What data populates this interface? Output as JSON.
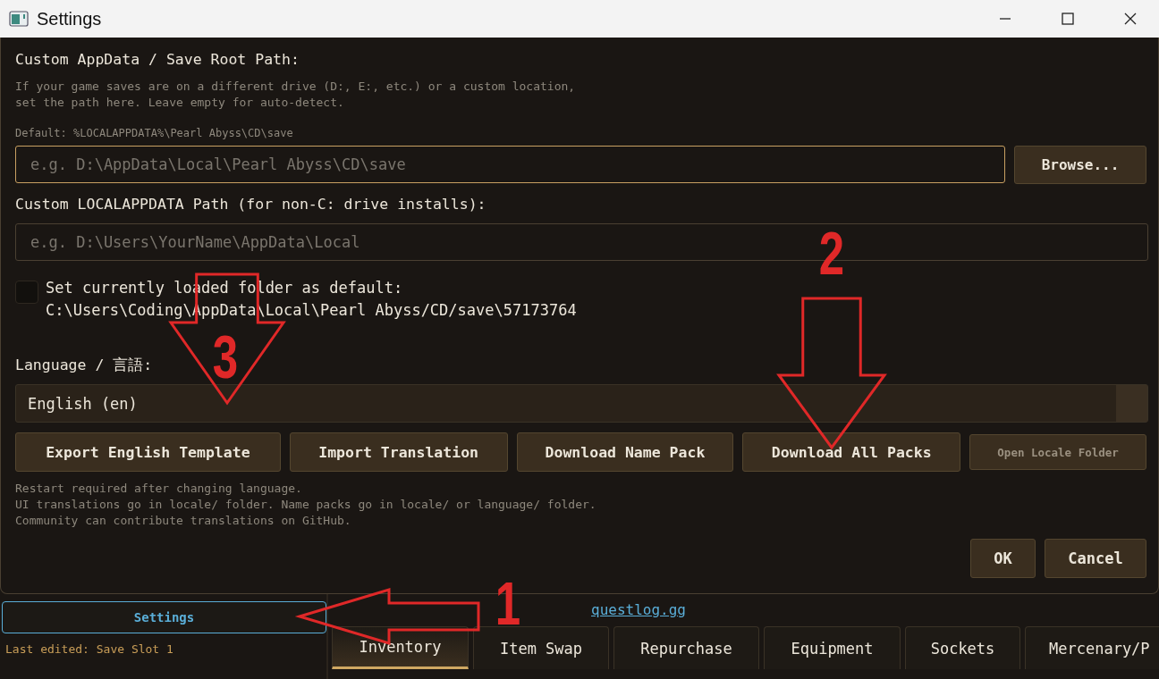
{
  "window": {
    "title": "Settings"
  },
  "dialog": {
    "save_root": {
      "label": "Custom AppData / Save Root Path:",
      "help": [
        "If your game saves are on a different drive (D:, E:, etc.) or a custom location,",
        "set the path here. Leave empty for auto-detect."
      ],
      "default_note": "Default: %LOCALAPPDATA%\\Pearl Abyss\\CD\\save",
      "placeholder": "e.g. D:\\AppData\\Local\\Pearl Abyss\\CD\\save",
      "browse": "Browse..."
    },
    "localappdata": {
      "label": "Custom LOCALAPPDATA Path (for non-C: drive installs):",
      "placeholder": "e.g. D:\\Users\\YourName\\AppData\\Local"
    },
    "default_checkbox": {
      "checked": false,
      "lines": [
        "Set currently loaded folder as default:",
        "C:\\Users\\Coding\\AppData\\Local\\Pearl Abyss/CD/save\\57173764"
      ]
    },
    "language": {
      "label": "Language / 言語:",
      "value": "English (en)"
    },
    "language_buttons": [
      {
        "label": "Export English Template",
        "disabled": false
      },
      {
        "label": "Import Translation",
        "disabled": false
      },
      {
        "label": "Download Name Pack",
        "disabled": false
      },
      {
        "label": "Download All Packs",
        "disabled": false
      },
      {
        "label": "Open Locale Folder",
        "disabled": true
      }
    ],
    "notes": [
      "Restart required after changing language.",
      "UI translations go in locale/ folder. Name packs go in locale/ or language/ folder.",
      "Community can contribute translations on GitHub."
    ],
    "buttons": [
      "OK",
      "Cancel"
    ]
  },
  "sidebar": {
    "settings_button": "Settings",
    "last_edited": "Last edited: Save Slot 1"
  },
  "credit": {
    "link": "questlog.gg"
  },
  "tabs": [
    {
      "label": "Inventory",
      "selected": true
    },
    {
      "label": "Item Swap",
      "selected": false
    },
    {
      "label": "Repurchase",
      "selected": false
    },
    {
      "label": "Equipment",
      "selected": false
    },
    {
      "label": "Sockets",
      "selected": false
    },
    {
      "label": "Mercenary/P",
      "selected": false
    }
  ],
  "annotations": [
    {
      "number": "1",
      "kind": "left"
    },
    {
      "number": "2",
      "kind": "down"
    },
    {
      "number": "3",
      "kind": "down"
    }
  ]
}
